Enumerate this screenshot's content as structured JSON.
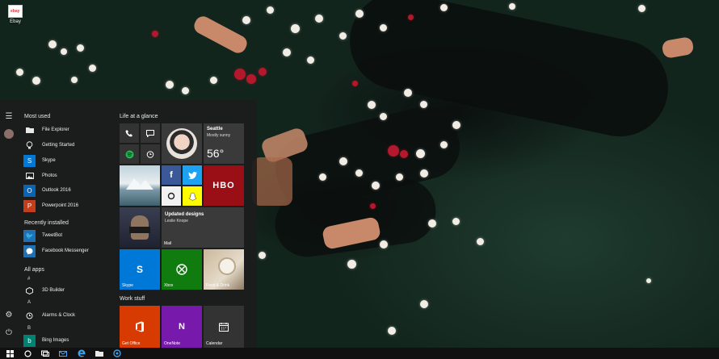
{
  "desktop": {
    "icons": [
      {
        "label": "Ebay",
        "icon": "ebay-icon"
      }
    ]
  },
  "start_menu": {
    "rail": {
      "icons": [
        "hamburger-icon",
        "user-avatar",
        "settings-icon",
        "power-icon"
      ]
    },
    "most_used": {
      "header": "Most used",
      "items": [
        {
          "label": "File Explorer",
          "icon": "folder-icon"
        },
        {
          "label": "Getting Started",
          "icon": "lightbulb-icon"
        },
        {
          "label": "Skype",
          "icon": "skype-icon",
          "color": "#0078d7"
        },
        {
          "label": "Photos",
          "icon": "photos-icon"
        },
        {
          "label": "Outlook 2016",
          "icon": "outlook-icon",
          "color": "#0a64b4"
        },
        {
          "label": "Powerpoint 2016",
          "icon": "powerpoint-icon",
          "color": "#c43e1c"
        }
      ]
    },
    "recently_installed": {
      "header": "Recently installed",
      "items": [
        {
          "label": "TweetBot",
          "icon": "tweetbot-icon",
          "color": "#1b72b8"
        },
        {
          "label": "Facebook Messenger",
          "icon": "messenger-icon",
          "color": "#1b72b8"
        }
      ]
    },
    "all_apps": {
      "header": "All apps",
      "groups": [
        {
          "letter": "#",
          "items": [
            {
              "label": "3D Builder",
              "icon": "3d-builder-icon"
            }
          ]
        },
        {
          "letter": "A",
          "items": [
            {
              "label": "Alarms & Clock",
              "icon": "alarm-icon"
            }
          ]
        },
        {
          "letter": "B",
          "items": [
            {
              "label": "Bing Images",
              "icon": "bing-icon",
              "color": "#008272"
            }
          ]
        }
      ]
    },
    "tiles": {
      "life_header": "Life at a glance",
      "small": [
        {
          "name": "phone-tile",
          "icon": "phone-icon"
        },
        {
          "name": "messaging-tile",
          "icon": "message-icon"
        },
        {
          "name": "spotify-tile",
          "icon": "spotify-icon"
        },
        {
          "name": "alarm-tile",
          "icon": "alarm-icon"
        },
        {
          "name": "facebook-tile",
          "icon": "facebook-icon",
          "color": "#3b5998"
        },
        {
          "name": "twitter-tile",
          "icon": "twitter-icon",
          "color": "#1da1f2"
        },
        {
          "name": "camera-tile",
          "icon": "camera-icon"
        },
        {
          "name": "snapchat-tile",
          "icon": "snapchat-icon",
          "color": "#fffc00"
        }
      ],
      "weather": {
        "city": "Seattle",
        "condition": "Mostly sunny",
        "temp": "56°"
      },
      "hbo": {
        "logo": "HBO"
      },
      "mail": {
        "title": "Updated designs",
        "from": "Leslie Knope",
        "label": "Mail"
      },
      "skype": {
        "label": "Skype",
        "color": "#0078d7"
      },
      "xbox": {
        "label": "Xbox",
        "color": "#107c10"
      },
      "food": {
        "label": "Food & Drink"
      },
      "work_header": "Work stuff",
      "office": {
        "label": "Get Office",
        "color": "#d83b01"
      },
      "onenote": {
        "label": "OneNote",
        "color": "#7719aa"
      },
      "calendar": {
        "label": "Calendar"
      }
    }
  },
  "taskbar": {
    "icons": [
      "windows-start-icon",
      "cortana-search-icon",
      "task-view-icon",
      "mail-icon",
      "edge-icon",
      "file-explorer-icon",
      "app-icon"
    ]
  }
}
